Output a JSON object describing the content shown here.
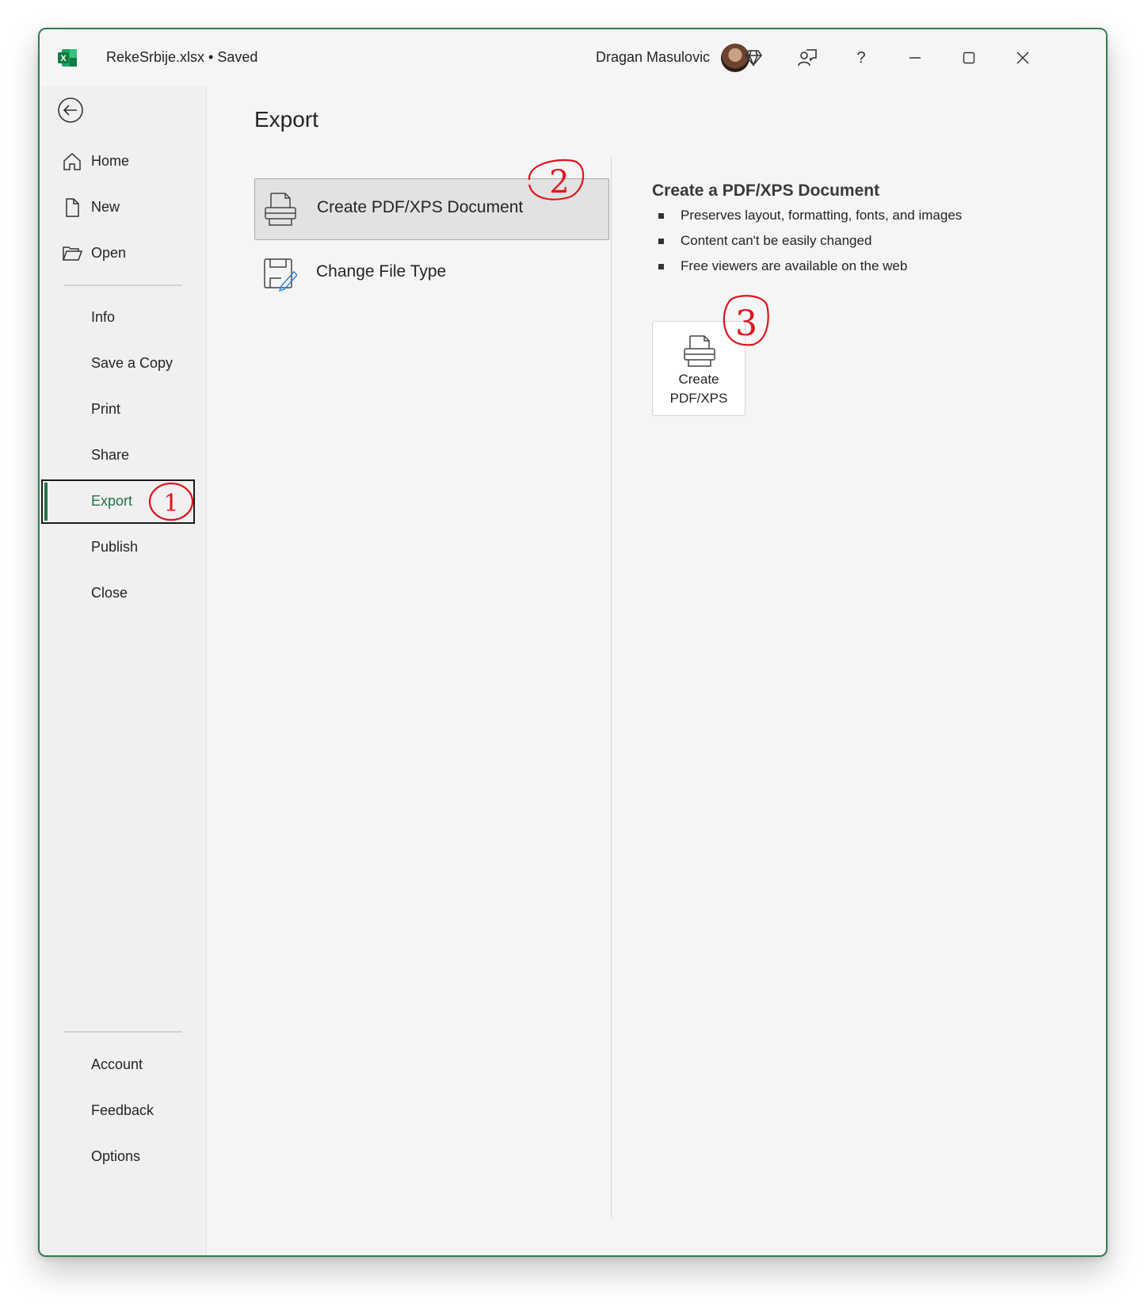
{
  "window": {
    "title": "RekeSrbije.xlsx • Saved",
    "user_name": "Dragan Masulovic",
    "accent": "#217346",
    "icons": [
      "excel-app-icon",
      "diamond-icon",
      "coauthor-icon",
      "help-icon",
      "minimize-icon",
      "maximize-icon",
      "close-icon"
    ],
    "help_glyph": "?"
  },
  "sidebar": {
    "back_icon": "back-arrow-icon",
    "top_items": [
      {
        "label": "Home",
        "icon": "home-icon"
      },
      {
        "label": "New",
        "icon": "new-file-icon"
      },
      {
        "label": "Open",
        "icon": "folder-open-icon"
      }
    ],
    "middle_items": [
      {
        "label": "Info"
      },
      {
        "label": "Save a Copy"
      },
      {
        "label": "Print"
      },
      {
        "label": "Share"
      },
      {
        "label": "Export",
        "selected": true
      },
      {
        "label": "Publish"
      },
      {
        "label": "Close"
      }
    ],
    "bottom_items": [
      {
        "label": "Account"
      },
      {
        "label": "Feedback"
      },
      {
        "label": "Options"
      }
    ]
  },
  "main": {
    "title": "Export",
    "options": [
      {
        "label": "Create PDF/XPS Document",
        "icon": "pdf-document-icon",
        "active": true
      },
      {
        "label": "Change File Type",
        "icon": "change-file-type-icon",
        "active": false
      }
    ],
    "detail": {
      "title": "Create a PDF/XPS Document",
      "bullets": [
        "Preserves layout, formatting, fonts, and images",
        "Content can't be easily changed",
        "Free viewers are available on the web"
      ],
      "button": {
        "line1": "Create",
        "line2": "PDF/XPS",
        "icon": "pdf-document-icon"
      }
    }
  },
  "annotations": {
    "color": "#e0141e",
    "marks": [
      "1",
      "2",
      "3"
    ]
  }
}
